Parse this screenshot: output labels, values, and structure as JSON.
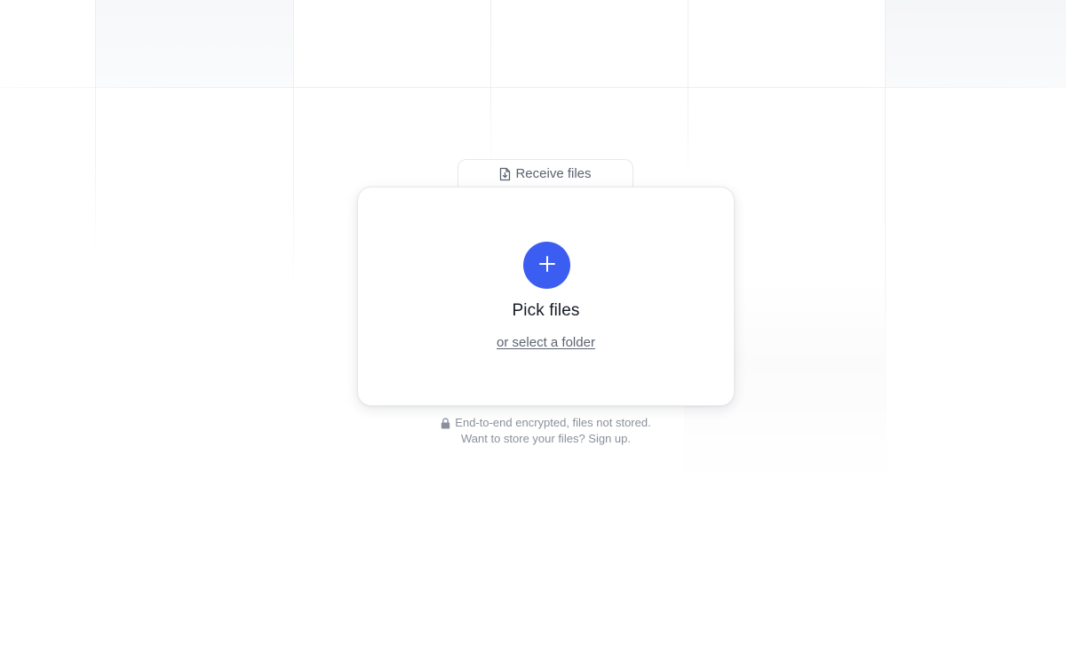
{
  "receive_tab": {
    "icon": "file-download-icon",
    "label": "Receive files"
  },
  "card": {
    "add_icon": "plus-icon",
    "title": "Pick files",
    "folder_link": "or select a folder"
  },
  "note": {
    "lock_icon": "lock-icon",
    "encryption_text": "End-to-end encrypted, files not stored.",
    "signup_text": "Want to store your files? Sign up."
  },
  "colors": {
    "accent": "#3c5df1",
    "text_primary": "#151a24",
    "text_muted": "#8a909b"
  }
}
